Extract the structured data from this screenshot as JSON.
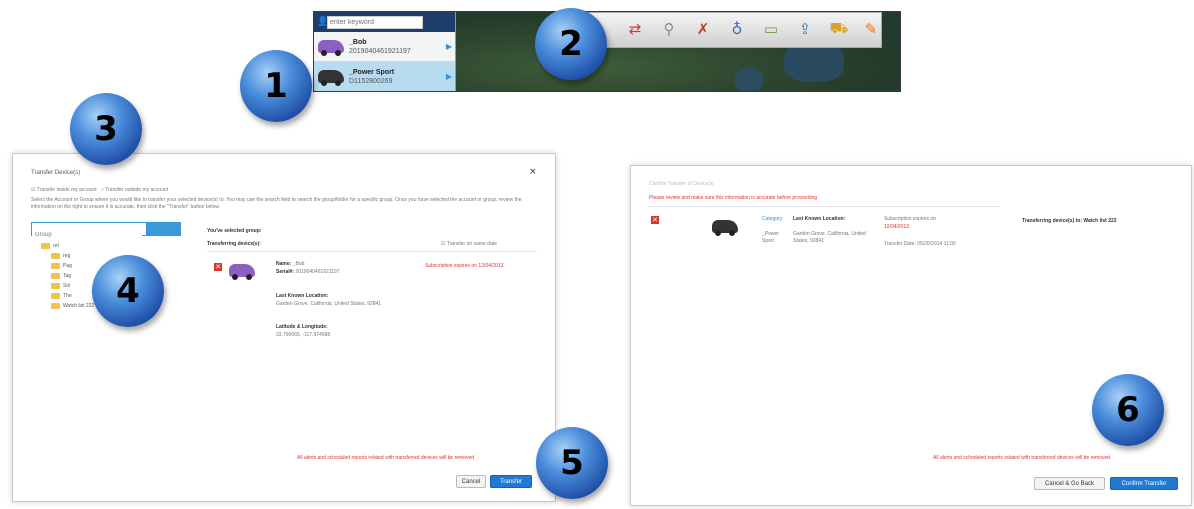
{
  "top": {
    "search_placeholder": "enter keyword",
    "devices": [
      {
        "name": "_Bob",
        "serial": "2019040461921197",
        "color": "#8c5fc2"
      },
      {
        "name": "_Power Sport",
        "serial": "D1152800269",
        "color": "#333333"
      }
    ],
    "tools": [
      {
        "icon": "transfer-arrows-icon",
        "glyph": "⇄",
        "color": "#d43b2f"
      },
      {
        "icon": "map-pin-icon",
        "glyph": "⚲",
        "color": "#8a8a8a"
      },
      {
        "icon": "tools-wrench-icon",
        "glyph": "✗",
        "color": "#c0392b"
      },
      {
        "icon": "joystick-icon",
        "glyph": "♁",
        "color": "#2f6fbf"
      },
      {
        "icon": "monitor-icon",
        "glyph": "▭",
        "color": "#6d9b3a"
      },
      {
        "icon": "export-document-icon",
        "glyph": "⇪",
        "color": "#2c7fc9"
      },
      {
        "icon": "vehicle-icon",
        "glyph": "⛟",
        "color": "#d9a22b"
      },
      {
        "icon": "pencil-icon",
        "glyph": "✎",
        "color": "#e07b1f"
      }
    ]
  },
  "steps": [
    "1",
    "2",
    "3",
    "4",
    "5",
    "6"
  ],
  "left_dialog": {
    "title": "Transfer Device(s)",
    "close": "×",
    "radio_inside": "Transfer inside my account",
    "radio_outside": "Transfer outside my account",
    "instructions": "Select the Account or Group where you would like to transfer your selected device(s) to. You may use the search field to search the group/folder for a specific group. Once you have selected the account or group, review the information on the right to ensure it is accurate, then click the \"Transfer\" button below.",
    "search_placeholder": "Group",
    "tree": [
      "ret",
      "reg",
      "Pag",
      "Tag",
      "Sol",
      "The",
      "Watch list 222"
    ],
    "selected_group_label": "You've selected group:",
    "transferring_label": "Transferring device(s):",
    "transfer_same_date": "Transfer on same date",
    "device": {
      "name_label": "Name:",
      "name": "_Bob",
      "serial_label": "Serial#:",
      "serial": "2019040461921197",
      "subscription": "Subscription expires on 12/04/2013",
      "last_known_label": "Last Known Location:",
      "location": "Garden Grove, California, United States, 92841",
      "latlng_label": "Latitude & Longitude:",
      "latlng": "33.790665, -117.974688"
    },
    "warning": "All alerts and scheduled reports related with transferred devices will be removed",
    "cancel": "Cancel",
    "transfer": "Transfer"
  },
  "right_dialog": {
    "title": "Confirm Transfer of Device(s)",
    "review_warning": "Please review and make sure this information is accurate before proceeding",
    "device": {
      "category": "Category",
      "name": "_Power Sport",
      "last_known_label": "Last Known Location:",
      "location": "Garden Grove, California, United States, 92841",
      "subscription_label": "Subscription expires on",
      "subscription_date": "12/04/2013",
      "transfer_date": "Transfer Date: 05/20/2014 11:00"
    },
    "transferring_to": "Transferring device(s) to: Watch list 222",
    "warning": "All alerts and scheduled reports related with transferred devices will be removed",
    "cancel": "Cancel & Go Back",
    "confirm": "Confirm Transfer"
  }
}
